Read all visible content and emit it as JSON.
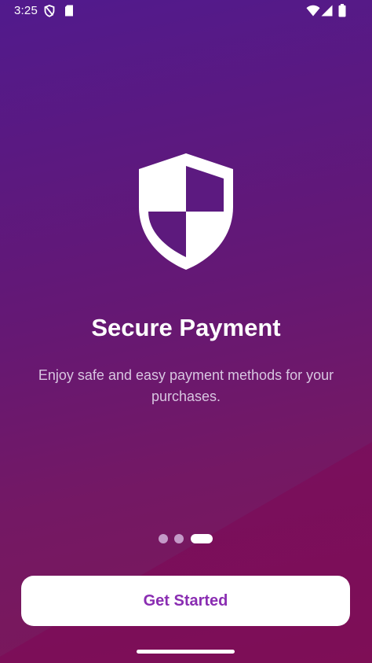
{
  "status_bar": {
    "time": "3:25",
    "icons": [
      "shield-status-icon",
      "sd-card-icon",
      "wifi-icon",
      "signal-icon",
      "battery-icon"
    ]
  },
  "onboarding": {
    "icon": "shield-icon",
    "title": "Secure Payment",
    "subtitle": "Enjoy safe and easy payment methods for your purchases.",
    "page_indicator": {
      "total": 3,
      "current": 3
    },
    "cta_label": "Get Started"
  },
  "colors": {
    "gradient_top": "#511a8d",
    "gradient_bottom": "#7c1758",
    "button_text": "#8a2db2",
    "dot_inactive": "#c49ac8"
  }
}
